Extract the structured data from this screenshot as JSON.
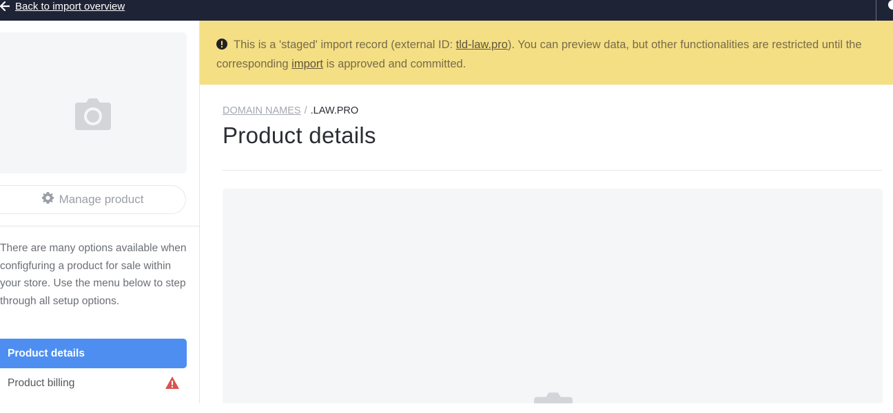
{
  "topbar": {
    "back_label": "Back to import overview",
    "back_icon": "arrow-left-icon"
  },
  "sidebar": {
    "image_icon": "camera-icon",
    "manage_button": {
      "label": "Manage product",
      "icon": "gear-icon"
    },
    "description": "There are many options available when configfuring a product for sale within your store. Use the menu below to step through all setup options.",
    "nav": [
      {
        "label": "Product details",
        "active": true
      },
      {
        "label": "Product billing",
        "active": false,
        "status_icon": "warning-triangle-icon"
      }
    ]
  },
  "notice": {
    "icon": "exclamation-circle-icon",
    "text_1": "This is a 'staged' import record (external ID: ",
    "external_id": "tld-law.pro",
    "text_2": "). You can preview data, but other functionalities are restricted until the corresponding ",
    "import_link": "import",
    "text_3": " is approved and committed."
  },
  "breadcrumb": {
    "parent": "DOMAIN NAMES",
    "separator": "/",
    "current": ".LAW.PRO"
  },
  "page": {
    "title": "Product details",
    "placeholder_icon": "camera-icon"
  },
  "colors": {
    "topbar": "#1f2336",
    "notice_bg": "#f5df84",
    "nav_active": "#4e8ef0",
    "warning": "#d9534f"
  }
}
